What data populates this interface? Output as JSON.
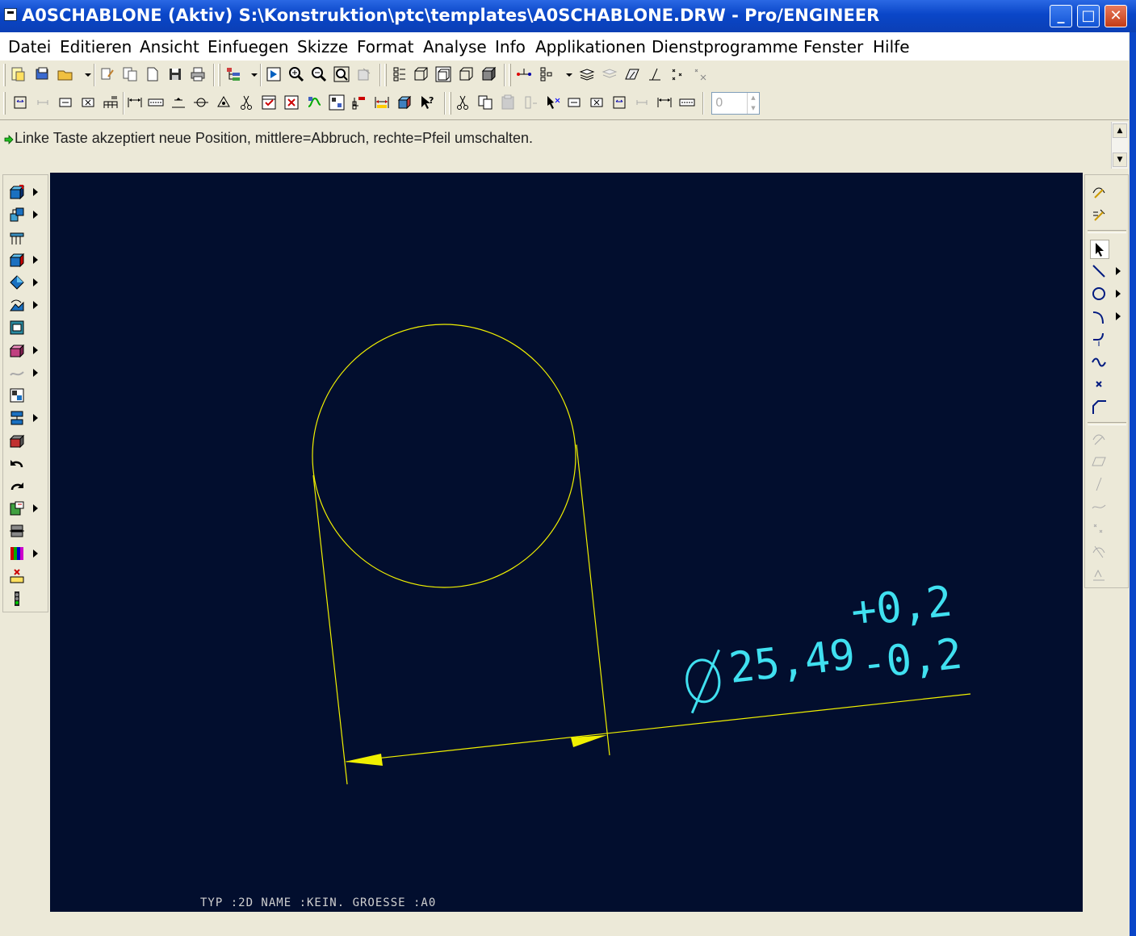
{
  "window": {
    "title": "A0SCHABLONE (Aktiv)  S:\\Konstruktion\\ptc\\templates\\A0SCHABLONE.DRW - Pro/ENGINEER",
    "minimize_label": "_",
    "maximize_label": "□",
    "close_label": "✕"
  },
  "menu": {
    "items": [
      {
        "label": "Datei"
      },
      {
        "label": "Editieren"
      },
      {
        "label": "Ansicht"
      },
      {
        "label": "Einfuegen"
      },
      {
        "label": "Skizze"
      },
      {
        "label": "Format"
      },
      {
        "label": "Analyse"
      },
      {
        "label": "Info"
      },
      {
        "label": "Applikationen"
      },
      {
        "label": "Dienstprogramme"
      },
      {
        "label": "Fenster"
      },
      {
        "label": "Hilfe"
      }
    ]
  },
  "toolbar": {
    "spinner_value": "0"
  },
  "message": {
    "text": "Linke Taste akzeptiert neue Position, mittlere=Abbruch, rechte=Pfeil umschalten."
  },
  "drawing": {
    "dimension_value": "25,49",
    "tolerance_upper": "+0,2",
    "tolerance_lower": "-0,2",
    "diameter_symbol": "Ø",
    "format_info": "TYP :2D   NAME :KEIN.   GROESSE :A0",
    "colors": {
      "background": "#020e2e",
      "geometry": "#f0f000",
      "dimension_text": "#40e0f0",
      "format_text": "#d0d0d0"
    }
  },
  "colors": {
    "titlebar": "#0a46c8",
    "chrome": "#ece9d8"
  }
}
